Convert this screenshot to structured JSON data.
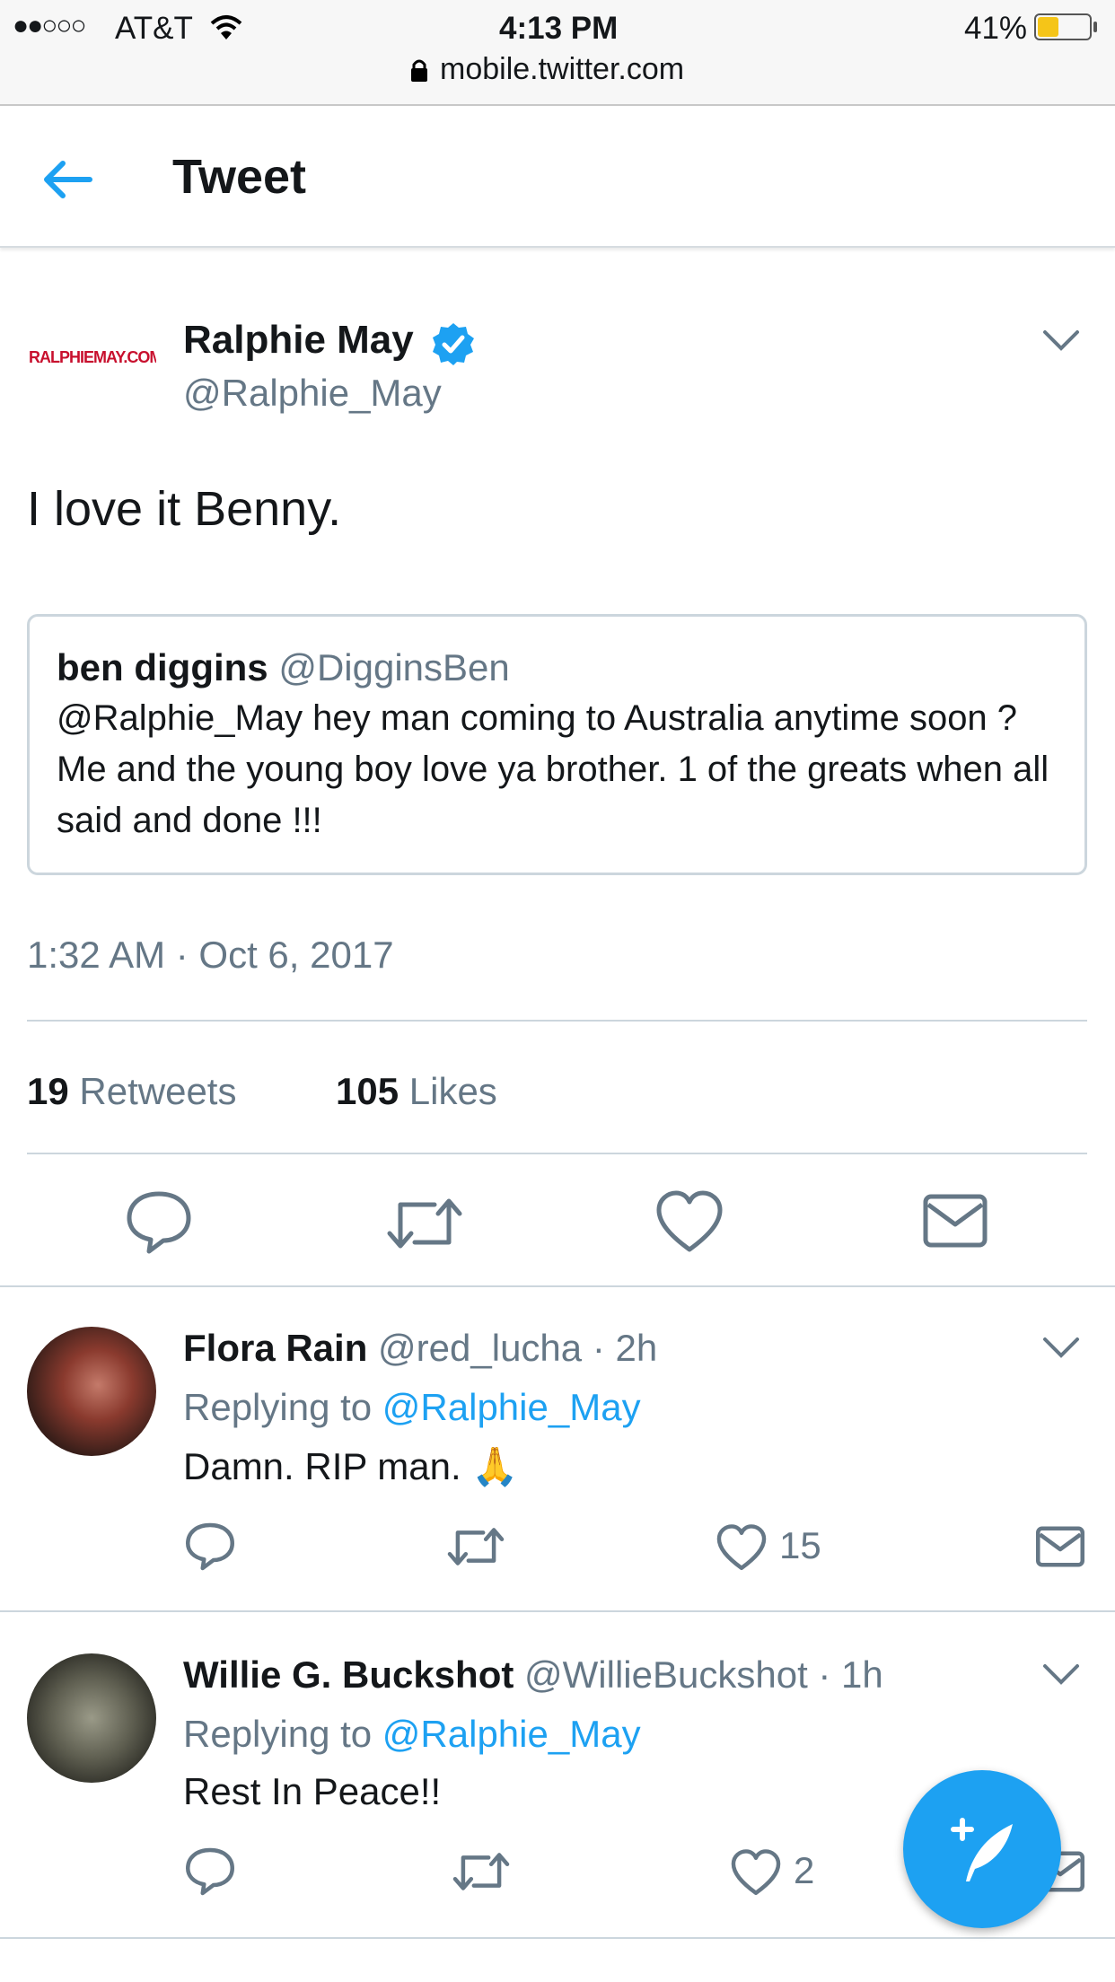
{
  "status_bar": {
    "signal": "●●○○○",
    "carrier": "AT&T",
    "time": "4:13 PM",
    "battery": "41%",
    "url": "mobile.twitter.com"
  },
  "header": {
    "title": "Tweet"
  },
  "tweet": {
    "avatar_text": "RALPHIEMAY.COM",
    "author_name": "Ralphie May",
    "author_handle": "@Ralphie_May",
    "text": "I love it Benny.",
    "quoted": {
      "author_name": "ben diggins",
      "author_handle": "@DigginsBen",
      "text": "@Ralphie_May hey man coming to Australia anytime soon ? Me and the young boy love ya brother. 1 of the greats when all said and done !!!"
    },
    "timestamp": "1:32 AM · Oct 6, 2017",
    "retweets_count": "19",
    "retweets_label": "Retweets",
    "likes_count": "105",
    "likes_label": "Likes"
  },
  "replies": [
    {
      "name": "Flora Rain",
      "handle": "@red_lucha",
      "time": "· 2h",
      "replying_label": "Replying to",
      "replying_to": "@Ralphie_May",
      "text": "Damn. RIP man. 🙏",
      "likes": "15"
    },
    {
      "name": "Willie G. Buckshot",
      "handle": "@WillieBuckshot",
      "time": "· 1h",
      "replying_label": "Replying to",
      "replying_to": "@Ralphie_May",
      "text": "Rest In Peace!!",
      "likes": "2"
    }
  ],
  "colors": {
    "accent": "#1da1f2",
    "verified": "#1da1f2",
    "battery": "#f5c518",
    "grey_text": "#657786"
  }
}
